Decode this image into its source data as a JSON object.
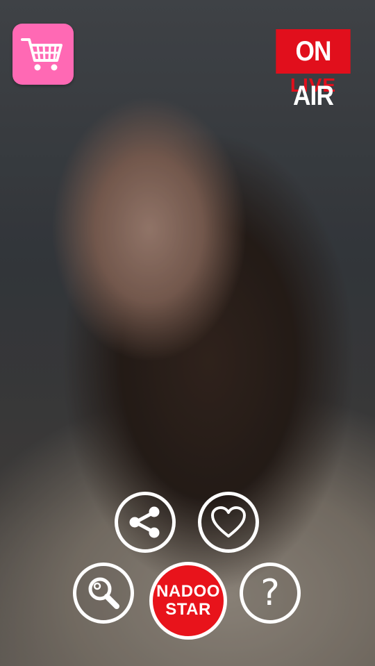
{
  "background": {
    "description_icon": "portrait-photo"
  },
  "cart": {
    "icon": "shopping-cart-icon",
    "color": "#ff69b4"
  },
  "onair": {
    "label": "ON AIR",
    "sub": "LIVE",
    "color": "#e10f1c"
  },
  "actions": {
    "share_icon": "share-icon",
    "like_icon": "heart-icon",
    "search_icon": "search-icon",
    "help_label": "?",
    "brand": {
      "line1": "NADOO",
      "line2": "STAR",
      "color": "#e8131b"
    }
  }
}
